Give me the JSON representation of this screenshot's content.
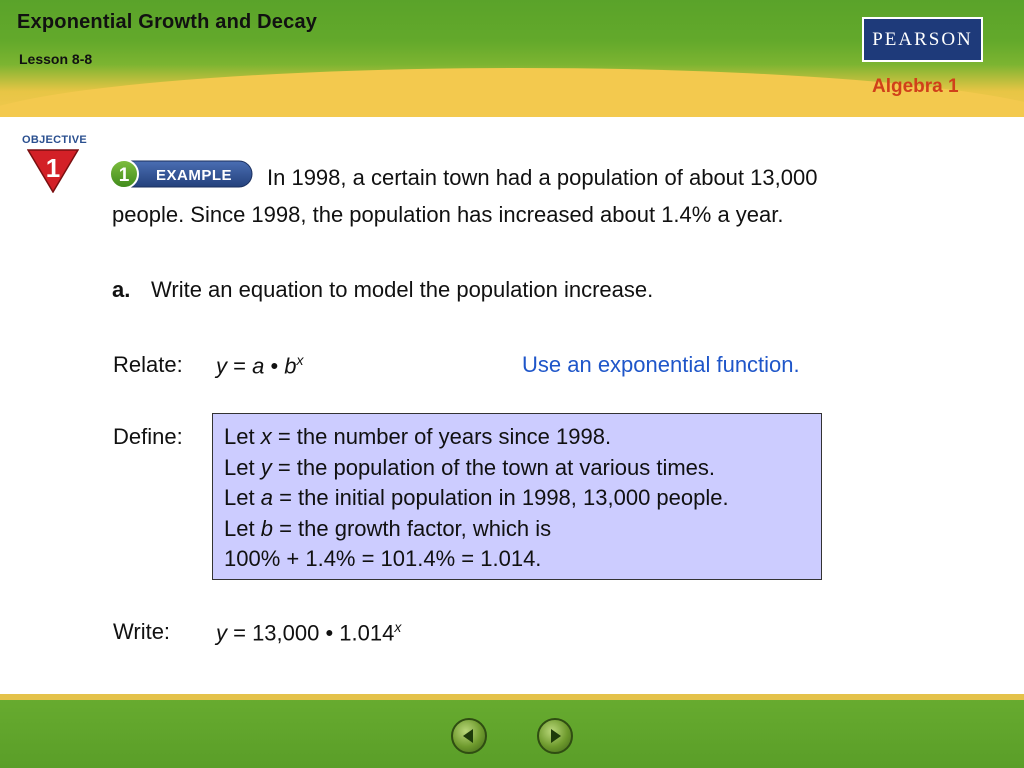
{
  "header": {
    "title": "Exponential Growth and Decay",
    "lesson": "Lesson 8-8",
    "publisher_logo": "PEARSON",
    "course": "Algebra 1"
  },
  "objective": {
    "label": "OBJECTIVE",
    "number": "1"
  },
  "example": {
    "number": "1",
    "label": "EXAMPLE"
  },
  "problem": {
    "line1": "In 1998, a certain town had a population of about 13,000",
    "line2": "people. Since 1998, the population has increased about 1.4% a year."
  },
  "part_a": {
    "marker": "a.",
    "prompt": "Write an equation to model the population increase."
  },
  "relate": {
    "label": "Relate:",
    "y": "y",
    "eq": " = ",
    "a": "a",
    "dot": " • ",
    "b": "b",
    "exp": "x",
    "hint": "Use an exponential function."
  },
  "define": {
    "label": "Define:",
    "lines": [
      {
        "let": "Let ",
        "var": "x",
        "rest": " = the number of years since 1998."
      },
      {
        "let": "Let ",
        "var": "y",
        "rest": " = the population of the town at various times."
      },
      {
        "let": "Let ",
        "var": "a",
        "rest": " = the initial population in 1998, 13,000 people."
      },
      {
        "let": "Let ",
        "var": "b",
        "rest": " = the growth factor, which is"
      }
    ],
    "last_line": "100% + 1.4% = 101.4% = 1.014."
  },
  "write": {
    "label": "Write:",
    "y": "y",
    "rest": " = 13,000 • 1.014",
    "exp": "x"
  },
  "nav": {
    "prev_icon": "arrow-left-icon",
    "next_icon": "arrow-right-icon"
  },
  "colors": {
    "header_green": "#5aa32a",
    "header_gold": "#f2c94f",
    "course_label": "#d0401a",
    "hint_blue": "#1f56c9",
    "define_box": "#ccccff",
    "objective_red": "#d32027",
    "example_blue": "#2d4e8e"
  }
}
